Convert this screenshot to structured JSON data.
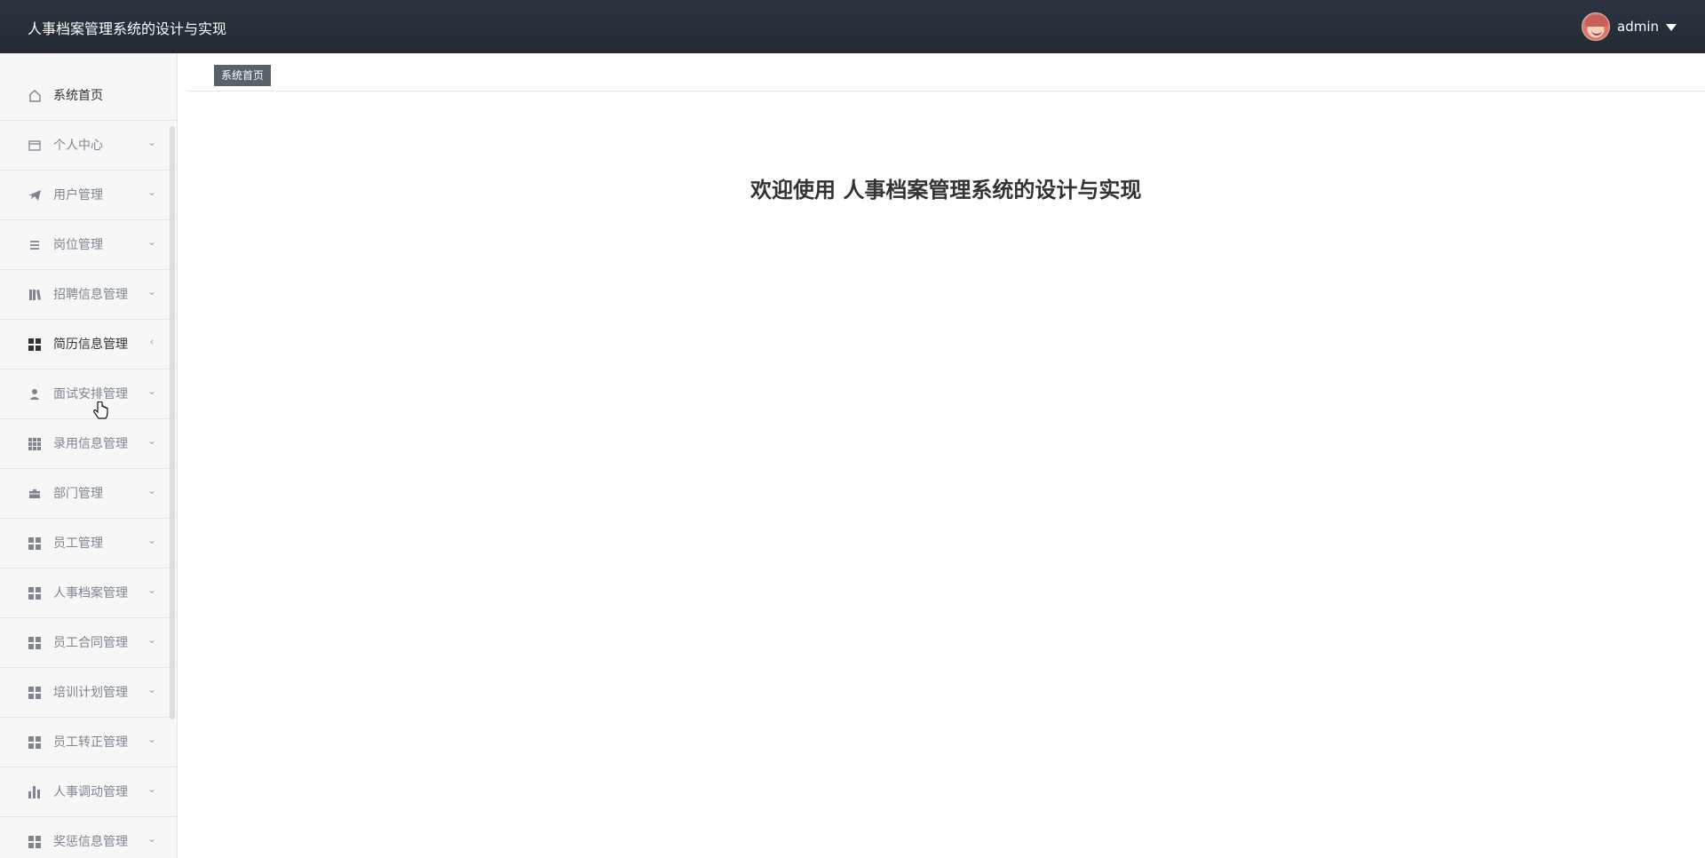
{
  "header": {
    "title": "人事档案管理系统的设计与实现",
    "user": "admin"
  },
  "sidebar": {
    "items": [
      {
        "label": "系统首页",
        "icon": "home-icon"
      },
      {
        "label": "个人中心",
        "icon": "card-icon"
      },
      {
        "label": "用户管理",
        "icon": "send-icon"
      },
      {
        "label": "岗位管理",
        "icon": "list-icon"
      },
      {
        "label": "招聘信息管理",
        "icon": "books-icon"
      },
      {
        "label": "简历信息管理",
        "icon": "grid-icon"
      },
      {
        "label": "面试安排管理",
        "icon": "user-icon"
      },
      {
        "label": "录用信息管理",
        "icon": "grid-nine-icon"
      },
      {
        "label": "部门管理",
        "icon": "briefcase-icon"
      },
      {
        "label": "员工管理",
        "icon": "grid-icon"
      },
      {
        "label": "人事档案管理",
        "icon": "grid-icon"
      },
      {
        "label": "员工合同管理",
        "icon": "grid-icon"
      },
      {
        "label": "培训计划管理",
        "icon": "grid-icon"
      },
      {
        "label": "员工转正管理",
        "icon": "grid-icon"
      },
      {
        "label": "人事调动管理",
        "icon": "bar-chart-icon"
      },
      {
        "label": "奖惩信息管理",
        "icon": "grid-icon"
      }
    ]
  },
  "tabs": [
    {
      "label": "系统首页"
    }
  ],
  "main": {
    "welcome": "欢迎使用 人事档案管理系统的设计与实现"
  },
  "colors": {
    "topbar": "#2b3440",
    "sidebar": "#f7f7f7",
    "tab": "#59616b",
    "text": "#303133"
  }
}
